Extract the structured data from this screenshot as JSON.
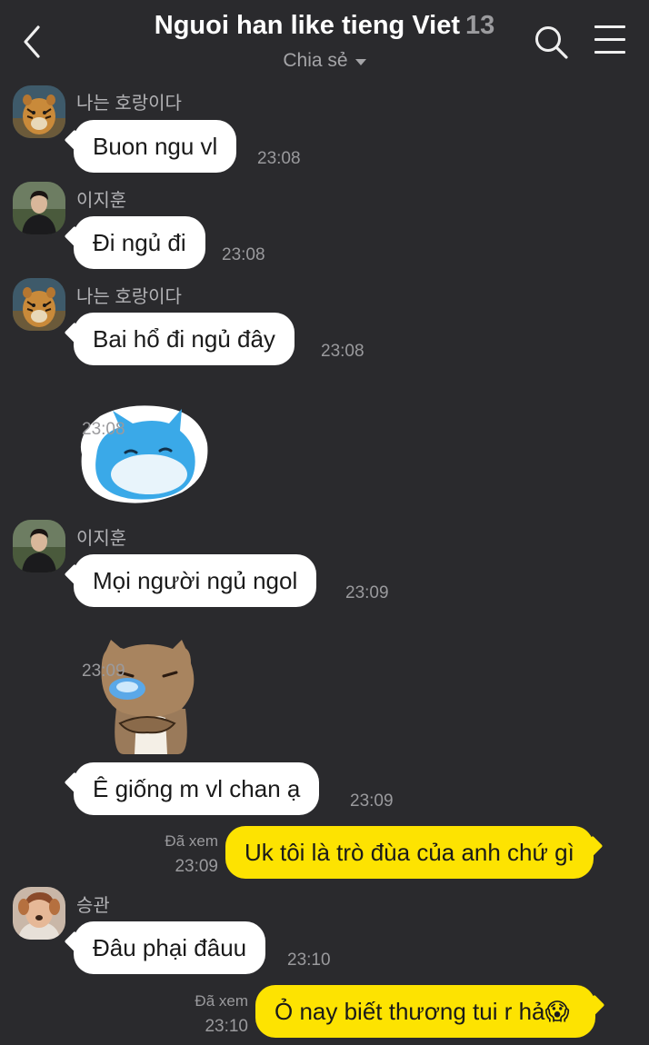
{
  "header": {
    "title": "Nguoi han like tieng Viet",
    "member_count": "13",
    "subtitle": "Chia sẻ",
    "back_icon": "chevron-left-icon",
    "search_icon": "search-icon",
    "menu_icon": "hamburger-menu-icon"
  },
  "colors": {
    "background": "#2a2a2d",
    "incoming_bubble": "#ffffff",
    "outgoing_bubble": "#fde301",
    "meta_text": "#9a9a9d"
  },
  "messages": [
    {
      "type": "text",
      "sender": "나는 호랑이다",
      "avatar": "tiger-avatar",
      "text": "Buon ngu vl",
      "time": "23:08"
    },
    {
      "type": "text",
      "sender": "이지훈",
      "avatar": "person-avatar",
      "text": "Đi ngủ đi",
      "time": "23:08"
    },
    {
      "type": "text",
      "sender": "나는 호랑이다",
      "avatar": "tiger-avatar",
      "text": "Bai hổ đi ngủ đây",
      "time": "23:08"
    },
    {
      "type": "sticker",
      "sticker": "blue-cat-pillow-sticker",
      "time": "23:08"
    },
    {
      "type": "text",
      "sender": "이지훈",
      "avatar": "person-avatar",
      "text": "Mọi người ngủ ngol",
      "time": "23:09"
    },
    {
      "type": "sticker",
      "sticker": "brown-cat-crossed-arms-sticker",
      "time": "23:09"
    },
    {
      "type": "text",
      "text": "Ê giống m vl chan ạ",
      "time": "23:09"
    },
    {
      "type": "outgoing",
      "read_label": "Đã xem",
      "text": "Uk tôi là trò đùa của anh chứ gì",
      "time": "23:09"
    },
    {
      "type": "text",
      "sender": "승관",
      "avatar": "puppy-filter-avatar",
      "text": "Đâu phại đâuu",
      "time": "23:10"
    },
    {
      "type": "outgoing",
      "read_label": "Đã xem",
      "text": "Ỏ nay biết thương tui r hả",
      "emoji": "😱",
      "time": "23:10"
    }
  ]
}
